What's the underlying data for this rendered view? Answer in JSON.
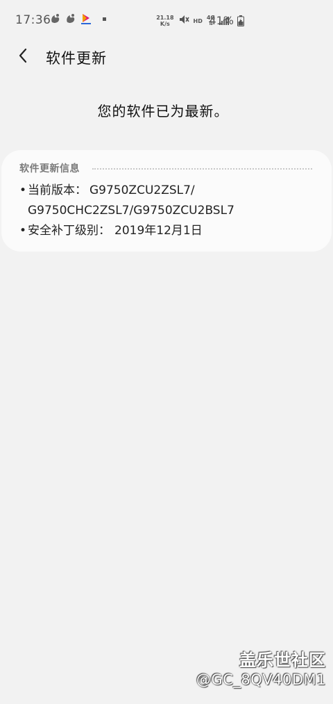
{
  "status_bar": {
    "time": "17:36",
    "net_speed_value": "21.18",
    "net_speed_unit": "K/s",
    "hd": "HD",
    "network": "4G",
    "battery_percent": "41%",
    "icons": [
      "uc-browser-icon",
      "uc-browser-icon",
      "app-notification-icon",
      "dot-icon",
      "mute-icon",
      "signal-icon",
      "battery-charging-icon"
    ]
  },
  "header": {
    "back_icon": "chevron-left-icon",
    "title": "软件更新"
  },
  "main": {
    "message": "您的软件已为最新。"
  },
  "info_card": {
    "title": "软件更新信息",
    "current_version_label": "当前版本：",
    "current_version_line1": "G9750ZCU2ZSL7/",
    "current_version_line2": "G9750CHC2ZSL7/G9750ZCU2BSL7",
    "security_patch_label": "安全补丁级别：",
    "security_patch_value": "2019年12月1日"
  },
  "watermark": {
    "brand": "盖乐世社区",
    "user": "@GC_8QV40DM1"
  },
  "colors": {
    "background": "#f2f2f2",
    "card": "#fbfbfb",
    "card_title": "#7a7a7a"
  }
}
